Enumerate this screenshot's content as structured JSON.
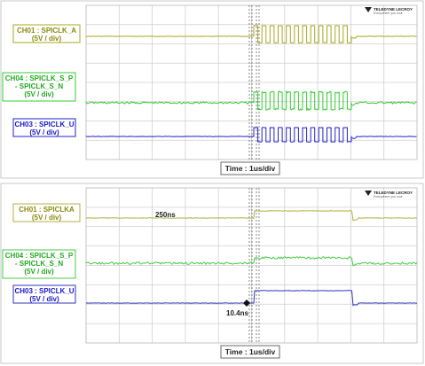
{
  "chart_data": [
    {
      "type": "line",
      "title": "",
      "xlabel": "Time : 1us/div",
      "x_divisions": 10,
      "logo": {
        "name": "TELEDYNE LECROY",
        "tagline": "Everywhere you look"
      },
      "series": [
        {
          "name": "CH01 : SPICLK_A",
          "scale": "(5V / div)",
          "color": "#a8a820",
          "label_color": "#8a8a10",
          "cycles": 12,
          "noise": false
        },
        {
          "name": "CH04 : SPICLK_S_P\n- SPICLK_S_N",
          "scale": "(5V / div)",
          "color": "#33cc33",
          "label_color": "#22aa22",
          "cycles": 12,
          "noise": true
        },
        {
          "name": "CH03 : SPICLK_U",
          "scale": "(5V / div)",
          "color": "#2222cc",
          "label_color": "#1a1acc",
          "cycles": 12,
          "noise": false
        }
      ],
      "annotations": []
    },
    {
      "type": "line",
      "title": "",
      "xlabel": "Time : 1us/div",
      "x_divisions": 10,
      "logo": {
        "name": "TELEDYNE LECROY",
        "tagline": "Everywhere you look"
      },
      "series": [
        {
          "name": "CH01 : SPICLKA",
          "scale": "(5V / div)",
          "color": "#b0b040",
          "label_color": "#8a8a10",
          "cycles": 1,
          "noise": false
        },
        {
          "name": "CH04 : SPICLK_S_P\n- SPICLK_S_N",
          "scale": "(5V / div)",
          "color": "#44cc44",
          "label_color": "#22aa22",
          "cycles": 1,
          "noise": true
        },
        {
          "name": "CH03 : SPICLK_U",
          "scale": "(5V / div)",
          "color": "#3333bb",
          "label_color": "#1a1acc",
          "cycles": 1,
          "noise": false
        }
      ],
      "annotations": [
        "250ns",
        "10.4ns"
      ]
    }
  ]
}
